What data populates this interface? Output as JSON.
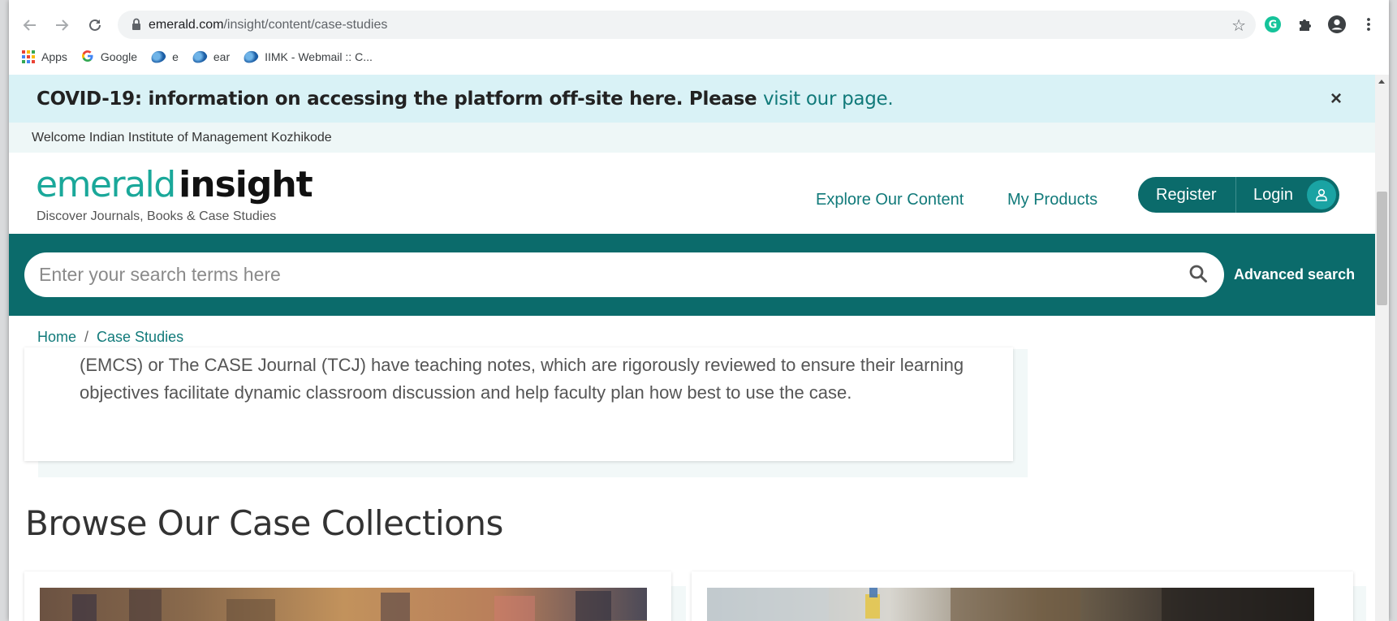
{
  "browser": {
    "url_domain": "emerald.com",
    "url_path": "/insight/content/case-studies",
    "bookmarks": [
      {
        "label": "Apps",
        "icon": "apps-grid-icon"
      },
      {
        "label": "Google",
        "icon": "google-icon"
      },
      {
        "label": "e",
        "icon": "bookmark-globe-icon"
      },
      {
        "label": "ear",
        "icon": "bookmark-globe-icon"
      },
      {
        "label": "IIMK - Webmail :: C...",
        "icon": "bookmark-globe-icon"
      }
    ]
  },
  "banner": {
    "text": "COVID-19: information on accessing the platform off-site here. Please ",
    "link": "visit our page.",
    "close": "×"
  },
  "welcome": "Welcome Indian Institute of Management Kozhikode",
  "header": {
    "logo_part1": "emerald",
    "logo_part2": "insight",
    "tagline": "Discover Journals, Books & Case Studies",
    "nav": [
      "Explore Our Content",
      "My Products"
    ],
    "register": "Register",
    "login": "Login"
  },
  "search": {
    "placeholder": "Enter your search terms here",
    "advanced": "Advanced search"
  },
  "breadcrumb": {
    "home": "Home",
    "separator": "/",
    "current": "Case Studies"
  },
  "panel": {
    "text": "(EMCS) or The CASE Journal (TCJ) have teaching notes, which are rigorously reviewed to ensure their learning objectives facilitate dynamic classroom discussion and help faculty plan how best to use the case."
  },
  "browse_title": "Browse Our Case Collections",
  "colors": {
    "brand_teal": "#0b6b6b",
    "accent_teal": "#1aa89a",
    "link_teal": "#117a7a",
    "banner_bg": "#d9f2f6"
  }
}
